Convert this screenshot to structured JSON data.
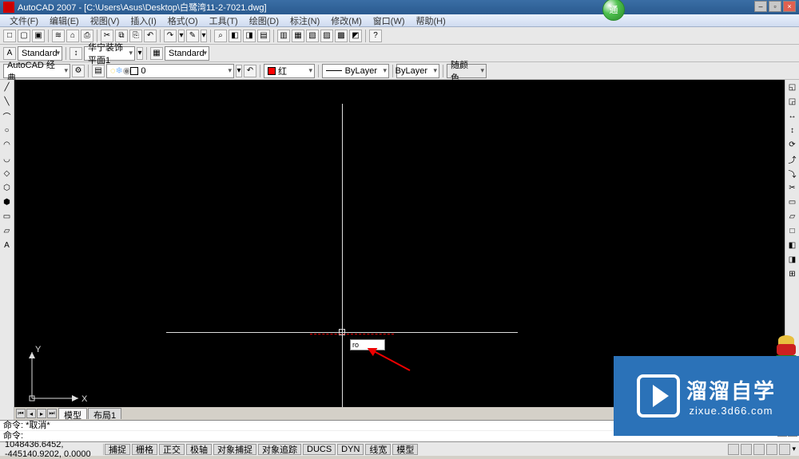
{
  "titlebar": {
    "app": "AutoCAD 2007",
    "doc": "[C:\\Users\\Asus\\Desktop\\白鹭湾11-2-7021.dwg]"
  },
  "orb_label": "通",
  "menu": [
    "文件(F)",
    "编辑(E)",
    "视图(V)",
    "插入(I)",
    "格式(O)",
    "工具(T)",
    "绘图(D)",
    "标注(N)",
    "修改(M)",
    "窗口(W)",
    "帮助(H)"
  ],
  "toolbar1_icons": [
    "□",
    "▢",
    "▣",
    "≋",
    "⌂",
    "⎙",
    "✂",
    "⧉",
    "⎘",
    "↶",
    "↷",
    "✎",
    "⌕",
    "◧",
    "◨",
    "▤",
    "▥",
    "▦",
    "▧",
    "▨",
    "▩",
    "◩",
    "?"
  ],
  "row2": {
    "textstyle_icon": "A",
    "textstyle": "Standard",
    "inner_combo": "华宁装饰平面1",
    "dimstyle_icon": "↕",
    "dimstyle": "Standard",
    "tablestyle_icon": "▦",
    "tablestyle": "Standard"
  },
  "row3": {
    "workspace": "AutoCAD 经典",
    "layer_icons": [
      "◌",
      "❄",
      "◉"
    ],
    "layer": "0",
    "color_name": "红",
    "linetype": "ByLayer",
    "lineweight": "ByLayer",
    "plotstyle": "随颜色"
  },
  "watermark": {
    "line1": "溜溜自学",
    "line2": "zixue.3d66.com"
  },
  "dyn_input": "ro",
  "ucs": {
    "x": "X",
    "y": "Y"
  },
  "tabs": {
    "model": "模型",
    "layout1": "布局1"
  },
  "cmd": {
    "line1": "命令: *取消*",
    "line2": "命令:"
  },
  "status": {
    "coords": "1048436.6452, -445140.9202, 0.0000",
    "toggles": [
      "捕捉",
      "栅格",
      "正交",
      "极轴",
      "对象捕捉",
      "对象追踪",
      "DUCS",
      "DYN",
      "线宽",
      "模型"
    ]
  },
  "left_tools": [
    "╱",
    "╲",
    "⌒",
    "○",
    "◠",
    "◡",
    "◇",
    "⬡",
    "⬢",
    "▭",
    "▱",
    "A"
  ],
  "right_tools": [
    "◱",
    "◲",
    "↔",
    "↕",
    "⟳",
    "⤴",
    "⤵",
    "✂",
    "▭",
    "▱",
    "□",
    "◧",
    "◨",
    "⊞"
  ]
}
